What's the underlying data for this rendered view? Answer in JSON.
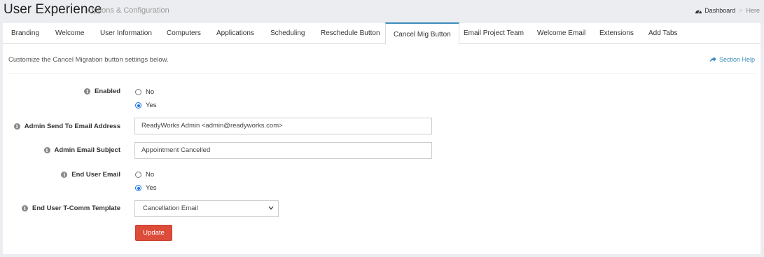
{
  "header": {
    "title": "User Experience",
    "subtitle": "Options & Configuration",
    "breadcrumb": {
      "dashboard": "Dashboard",
      "separator": ">",
      "current": "Here"
    }
  },
  "tabs": [
    {
      "label": "Branding",
      "active": false
    },
    {
      "label": "Welcome",
      "active": false
    },
    {
      "label": "User Information",
      "active": false
    },
    {
      "label": "Computers",
      "active": false
    },
    {
      "label": "Applications",
      "active": false
    },
    {
      "label": "Scheduling",
      "active": false
    },
    {
      "label": "Reschedule Button",
      "active": false
    },
    {
      "label": "Cancel Mig Button",
      "active": true
    },
    {
      "label": "Email Project Team",
      "active": false
    },
    {
      "label": "Welcome Email",
      "active": false
    },
    {
      "label": "Extensions",
      "active": false
    },
    {
      "label": "Add Tabs",
      "active": false
    }
  ],
  "content": {
    "intro": "Customize the Cancel Migration button settings below.",
    "section_help": "Section Help"
  },
  "form": {
    "enabled": {
      "label": "Enabled",
      "options": [
        "No",
        "Yes"
      ],
      "selected": "Yes"
    },
    "admin_send_to": {
      "label": "Admin Send To Email Address",
      "value": "ReadyWorks Admin <admin@readyworks.com>"
    },
    "admin_subject": {
      "label": "Admin Email Subject",
      "value": "Appointment Cancelled"
    },
    "end_user_email": {
      "label": "End User Email",
      "options": [
        "No",
        "Yes"
      ],
      "selected": "Yes"
    },
    "template": {
      "label": "End User T-Comm Template",
      "value": "Cancellation Email"
    },
    "update_label": "Update"
  },
  "colors": {
    "accent": "#3c8dbc",
    "update_button": "#dd4b39",
    "radio_checked": "#1a73e8"
  },
  "icons": [
    "dashboard-icon",
    "share-icon",
    "info-icon",
    "chevron-down-icon"
  ]
}
